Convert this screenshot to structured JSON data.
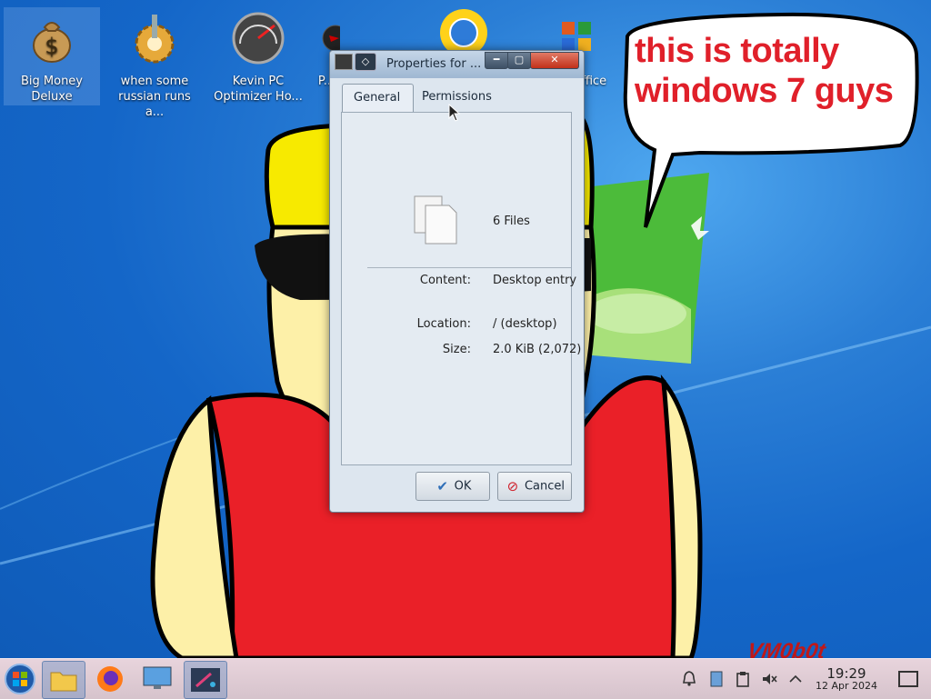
{
  "desktop": {
    "icons": [
      {
        "label": "Big Money Deluxe",
        "icon": "money-bag-icon"
      },
      {
        "label": "when some russian runs a...",
        "icon": "gear-icon"
      },
      {
        "label": "Kevin PC Optimizer Ho...",
        "icon": "gauge-icon"
      },
      {
        "label": "P...",
        "icon": "red-disc-icon"
      },
      {
        "label": "",
        "icon": "globe-sun-icon"
      },
      {
        "label": "...Office",
        "icon": "office-icon"
      }
    ],
    "bubble_text": "this is totally windows 7 guys",
    "signature": "VM0b0t"
  },
  "dialog": {
    "title": "Properties for ...",
    "tabs": [
      {
        "label": "General",
        "active": true
      },
      {
        "label": "Permissions",
        "active": false
      }
    ],
    "summary": "6 Files",
    "properties": [
      {
        "label": "Content:",
        "value": "Desktop entry"
      },
      {
        "label": "Location:",
        "value": "/ (desktop)"
      },
      {
        "label": "Size:",
        "value": "2.0 KiB (2,072)"
      }
    ],
    "buttons": {
      "ok": "OK",
      "cancel": "Cancel"
    }
  },
  "taskbar": {
    "apps": [
      {
        "name": "file-manager",
        "icon": "folder-icon"
      },
      {
        "name": "firefox",
        "icon": "firefox-icon"
      },
      {
        "name": "system-settings",
        "icon": "monitor-icon"
      },
      {
        "name": "properties-window",
        "icon": "kde-window-icon"
      }
    ],
    "clock": {
      "time": "19:29",
      "date": "12 Apr 2024"
    }
  }
}
